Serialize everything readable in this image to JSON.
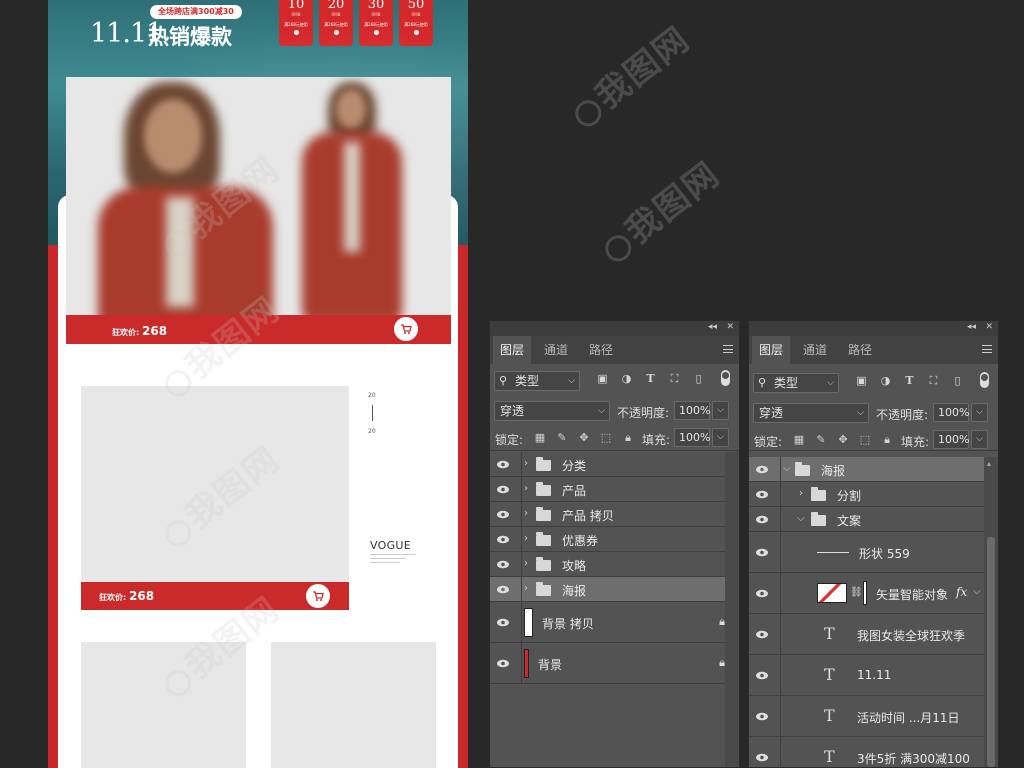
{
  "poster": {
    "promo_pill": "全场跨店满300减30",
    "title_number": "11.11",
    "title_text": "热销爆款",
    "coupons": [
      {
        "amount": "10",
        "unit": "RMB",
        "condition": "满268元使用"
      },
      {
        "amount": "20",
        "unit": "RMB",
        "condition": "满268元使用"
      },
      {
        "amount": "30",
        "unit": "RMB",
        "condition": "满268元使用"
      },
      {
        "amount": "50",
        "unit": "RMB",
        "condition": "满268元使用"
      }
    ],
    "product1": {
      "price_label": "狂欢价:",
      "price": "268"
    },
    "product2": {
      "price_label": "狂欢价:",
      "price": "268",
      "num_top": "20",
      "num_bottom": "20",
      "brand": "VOGUE"
    }
  },
  "watermark": {
    "text": "我图网"
  },
  "panel_left": {
    "tabs": [
      "图层",
      "通道",
      "路径"
    ],
    "active_tab": "图层",
    "filter_kind": "类型",
    "blend_mode": "穿透",
    "opacity_label": "不透明度:",
    "opacity_value": "100%",
    "lock_label": "锁定:",
    "fill_label": "填充:",
    "fill_value": "100%",
    "layers": [
      {
        "name": "分类",
        "type": "group"
      },
      {
        "name": "产品",
        "type": "group"
      },
      {
        "name": "产品 拷贝",
        "type": "group"
      },
      {
        "name": "优惠券",
        "type": "group"
      },
      {
        "name": "攻略",
        "type": "group"
      },
      {
        "name": "海报",
        "type": "group",
        "selected": true
      },
      {
        "name": "背景 拷贝",
        "type": "fill",
        "thumb_color": "#ffffff",
        "locked": true
      },
      {
        "name": "背景",
        "type": "fill",
        "thumb_color": "#c9282a",
        "locked": true
      }
    ]
  },
  "panel_right": {
    "tabs": [
      "图层",
      "通道",
      "路径"
    ],
    "active_tab": "图层",
    "filter_kind": "类型",
    "blend_mode": "穿透",
    "opacity_label": "不透明度:",
    "opacity_value": "100%",
    "lock_label": "锁定:",
    "fill_label": "填充:",
    "fill_value": "100%",
    "layers": [
      {
        "name": "海报",
        "type": "group",
        "expanded": true,
        "indent": 0
      },
      {
        "name": "分割",
        "type": "group",
        "expanded": false,
        "indent": 1
      },
      {
        "name": "文案",
        "type": "group",
        "expanded": true,
        "indent": 1
      },
      {
        "name": "形状 559",
        "type": "shape",
        "indent": 2
      },
      {
        "name": "矢量智能对象",
        "type": "smart",
        "fx": "fx",
        "indent": 2
      },
      {
        "name": "我图女装全球狂欢季",
        "type": "text",
        "indent": 2
      },
      {
        "name": "11.11",
        "type": "text",
        "indent": 2
      },
      {
        "name": "活动时间 ...月11日",
        "type": "text",
        "indent": 2
      },
      {
        "name": "3件5折  满300减100",
        "type": "text",
        "indent": 2
      }
    ]
  }
}
